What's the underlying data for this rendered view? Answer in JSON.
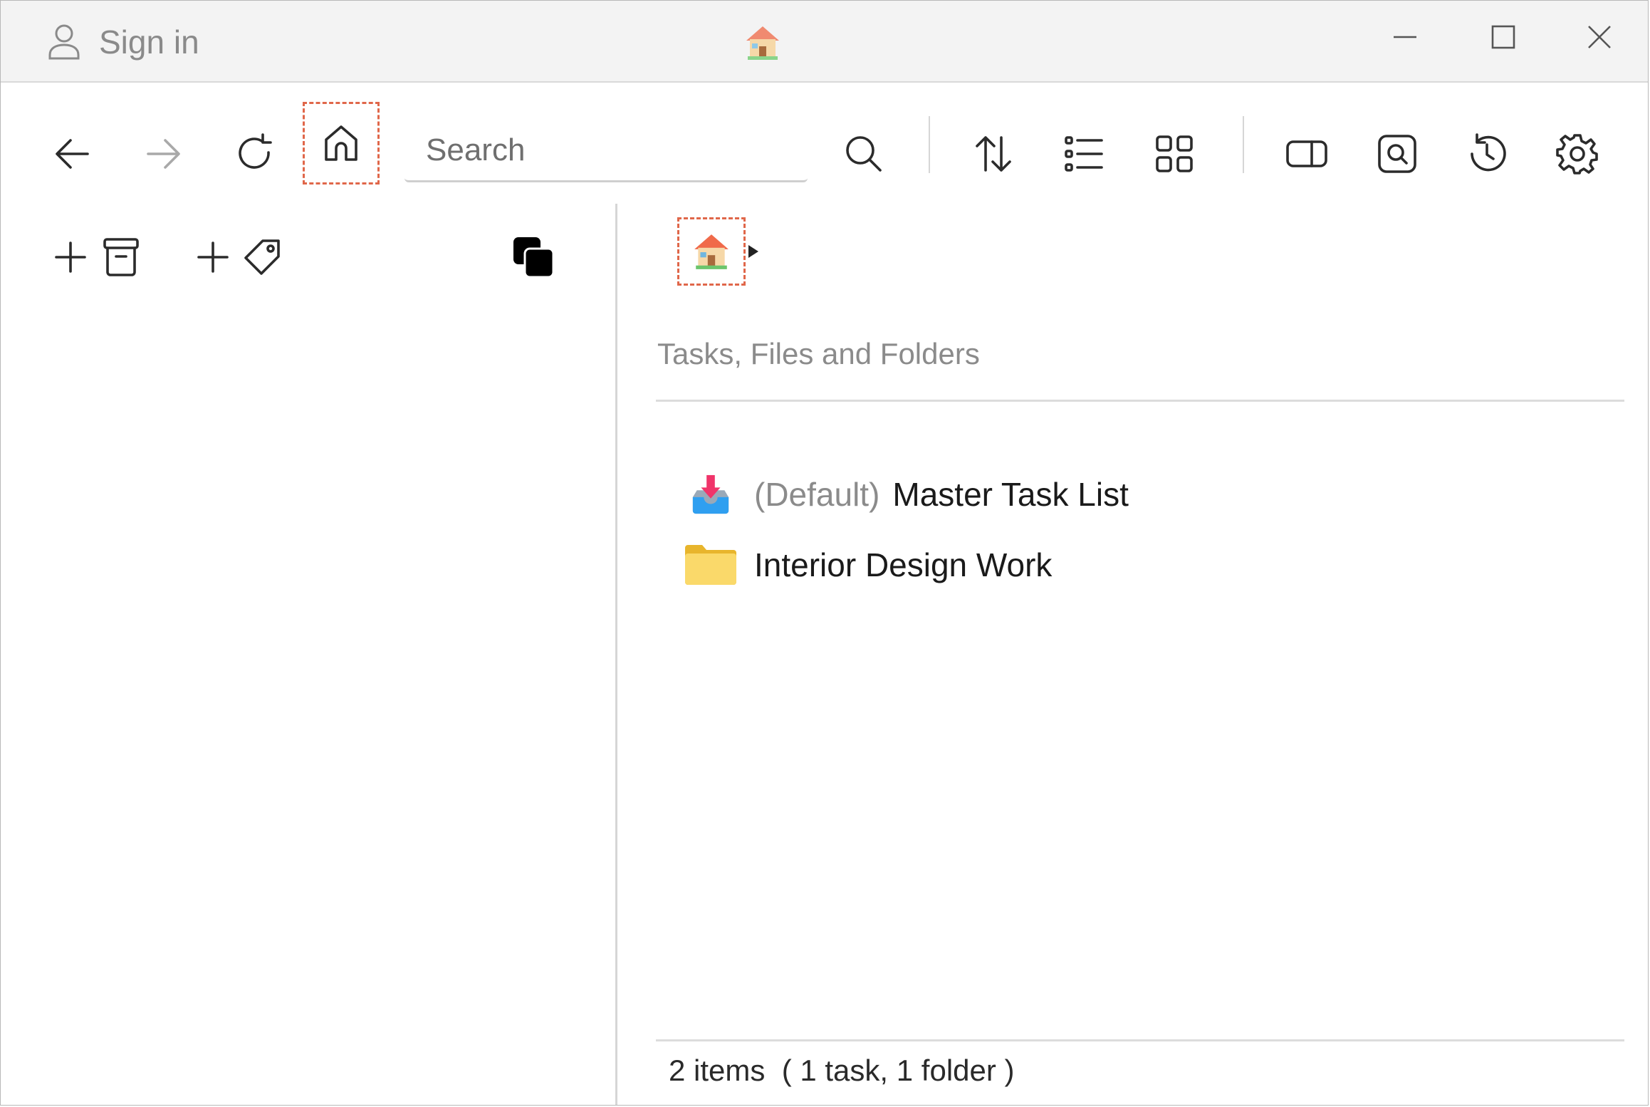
{
  "titlebar": {
    "signin_label": "Sign in",
    "home_icon": "house-emoji",
    "controls": [
      "minimize",
      "maximize",
      "close"
    ]
  },
  "toolbar": {
    "buttons": [
      "back-arrow",
      "forward-arrow",
      "refresh",
      "home",
      "search",
      "sort",
      "list-view",
      "grid-view",
      "toggle-panel",
      "preview",
      "history",
      "settings"
    ],
    "search_placeholder": "Search"
  },
  "sidebar": {
    "actions": [
      "add-archive",
      "add-tag",
      "copy"
    ]
  },
  "main": {
    "breadcrumb": {
      "root_icon": "house-emoji"
    },
    "section_title": "Tasks, Files and Folders",
    "items": [
      {
        "prefix": "(Default)",
        "name": "Master Task List",
        "icon": "inbox-tray-icon"
      },
      {
        "name": "Interior Design Work",
        "icon": "folder-icon"
      }
    ],
    "status_text": "2 items  ( 1 task, 1 folder )"
  },
  "colors": {
    "highlight": "#e0674a",
    "folder": "#f7cd45",
    "title_bg": "#f3f3f3"
  }
}
